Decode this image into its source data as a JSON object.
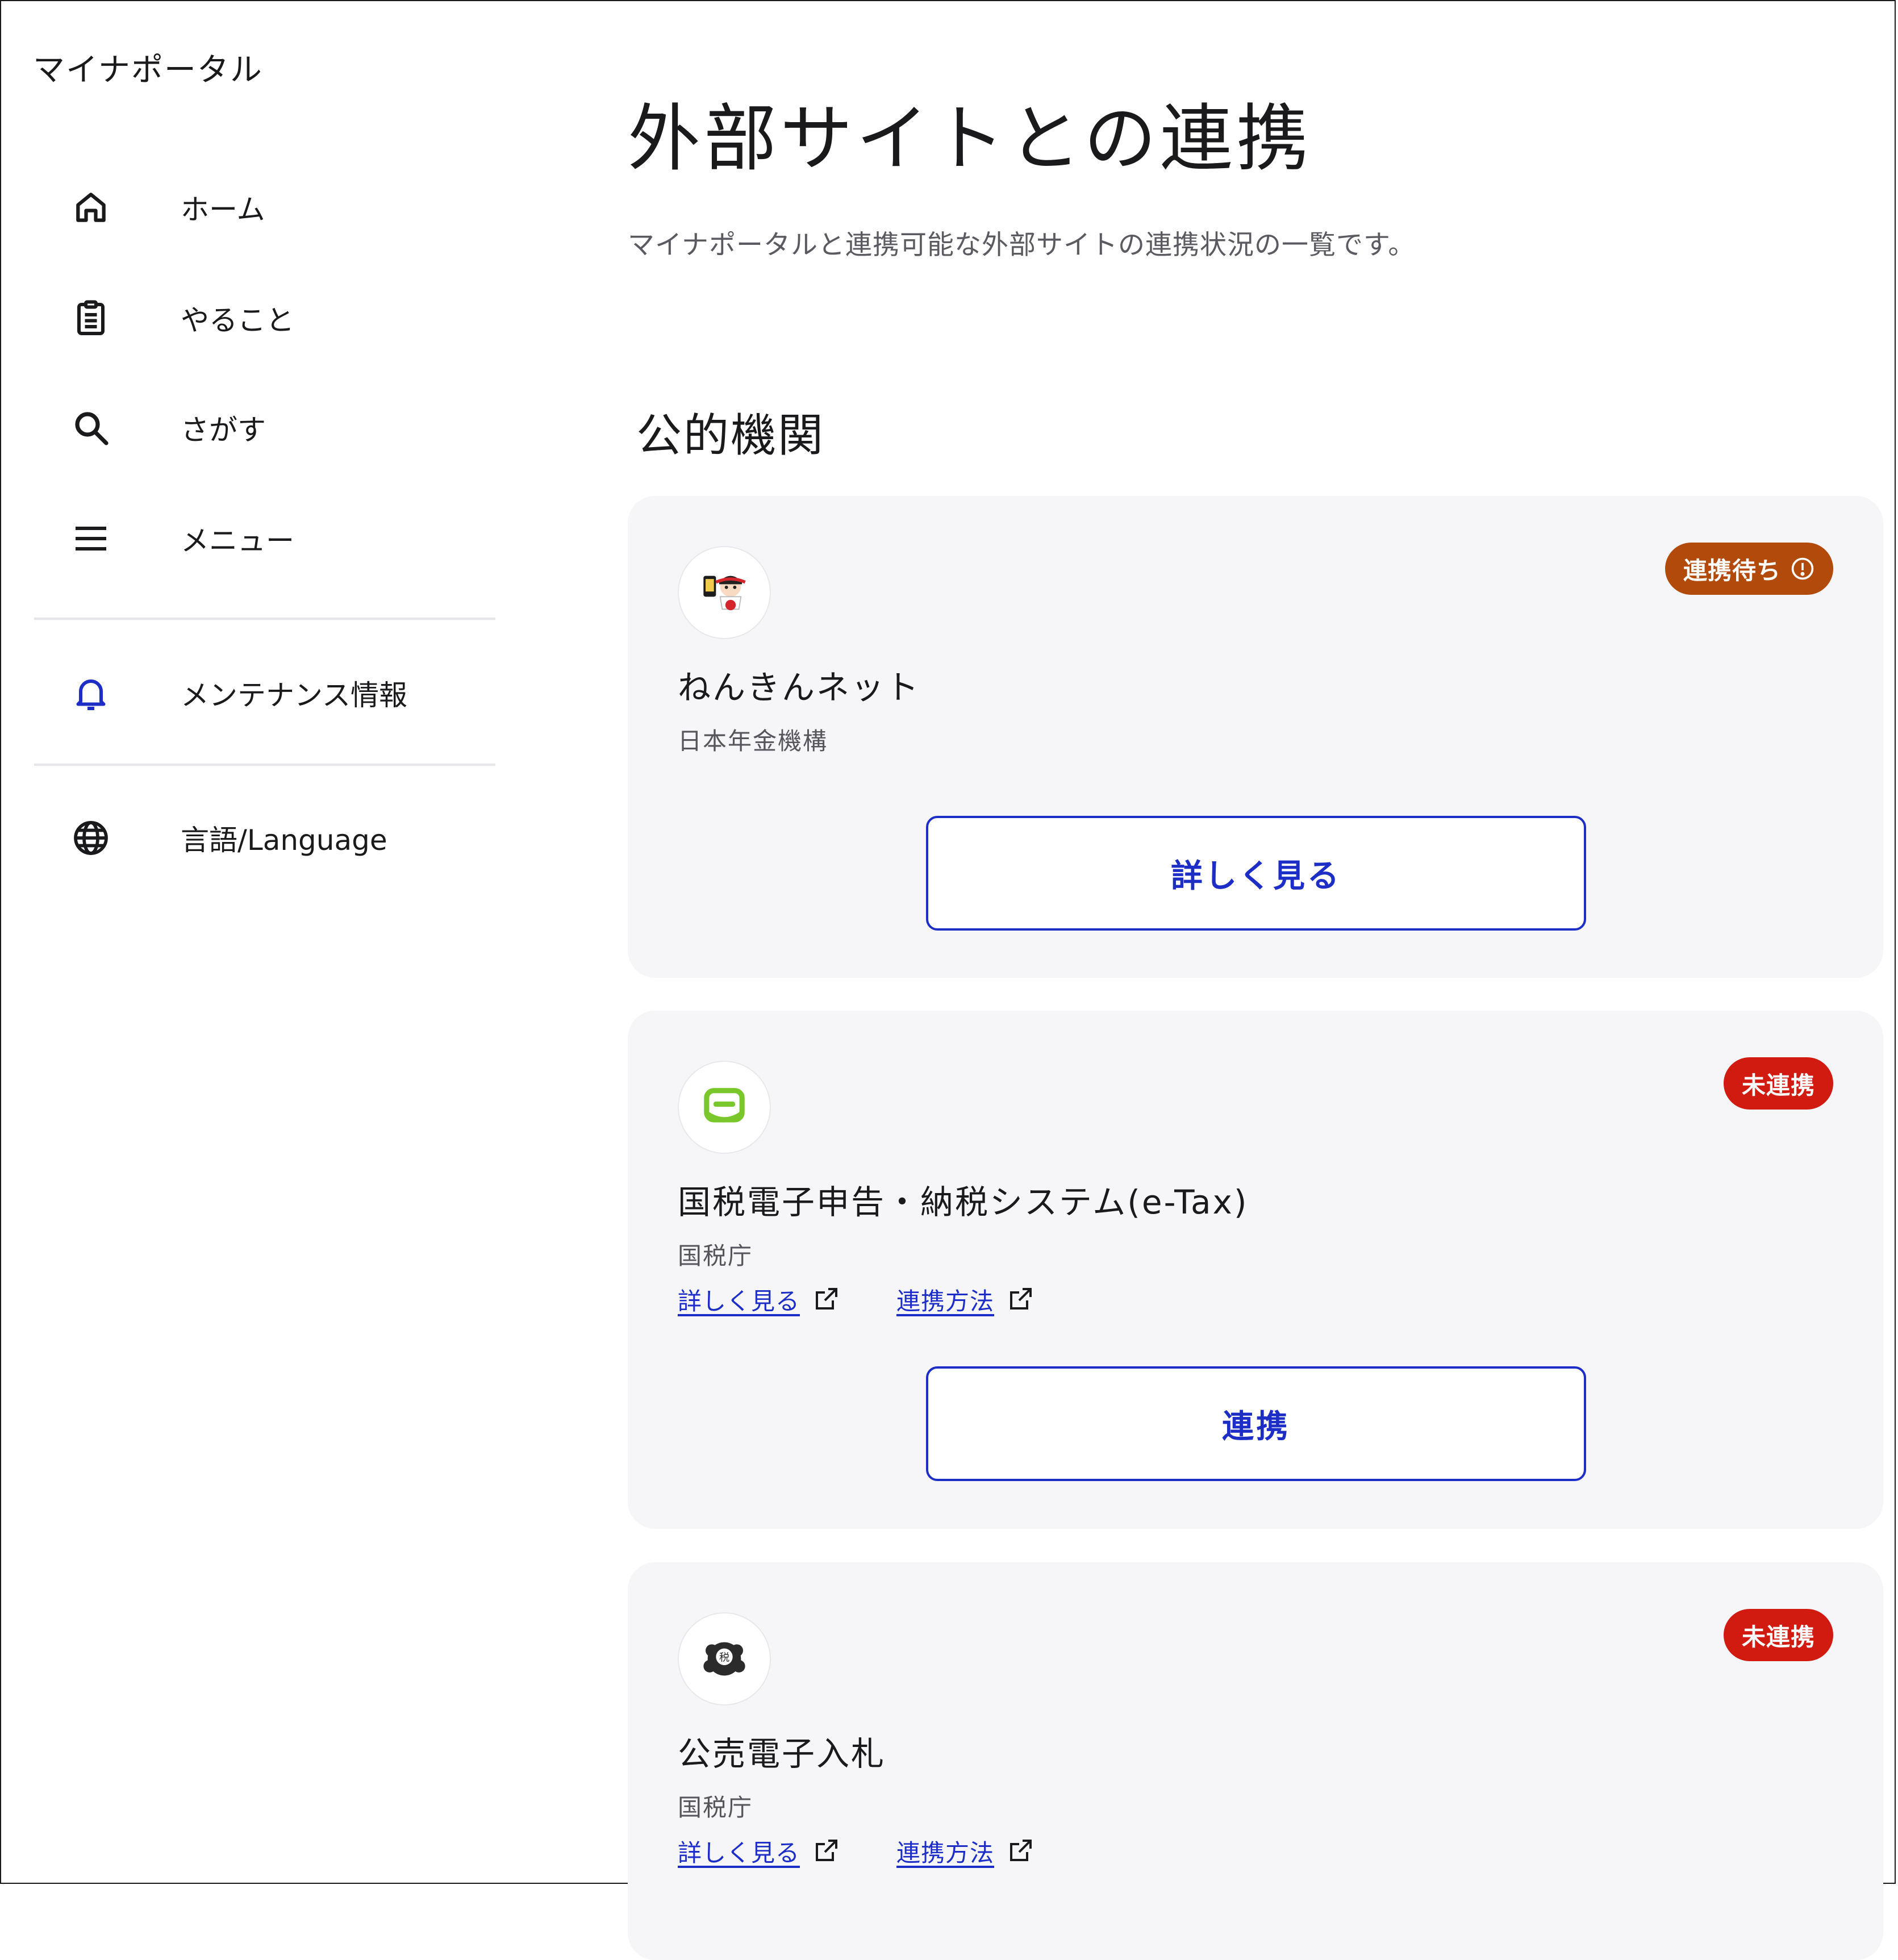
{
  "brand": "マイナポータル",
  "nav": {
    "home": "ホーム",
    "todo": "やること",
    "search": "さがす",
    "menu": "メニュー",
    "maintenance": "メンテナンス情報",
    "language": "言語/Language"
  },
  "page": {
    "title": "外部サイトとの連携",
    "description": "マイナポータルと連携可能な外部サイトの連携状況の一覧です。",
    "section_title": "公的機関"
  },
  "cards": [
    {
      "name": "ねんきんネット",
      "org": "日本年金機構",
      "status": "連携待ち",
      "status_color": "#b14a0b",
      "status_icon": "info-circle-icon",
      "button": "詳しく見る",
      "logo_icon": "nenkin-net-logo-icon"
    },
    {
      "name": "国税電子申告・納税システム(e-Tax)",
      "org": "国税庁",
      "status": "未連携",
      "status_color": "#d11b11",
      "link_details": "詳しく見る",
      "link_method": "連携方法",
      "button": "連携",
      "logo_icon": "etax-logo-icon"
    },
    {
      "name": "公売電子入札",
      "org": "国税庁",
      "status": "未連携",
      "status_color": "#d11b11",
      "link_details": "詳しく見る",
      "link_method": "連携方法",
      "logo_icon": "koubai-logo-icon"
    }
  ],
  "colors": {
    "accent": "#1d2ec6",
    "card_bg": "#f6f6f9",
    "pending": "#b14a0b",
    "unlinked": "#d11b11"
  }
}
